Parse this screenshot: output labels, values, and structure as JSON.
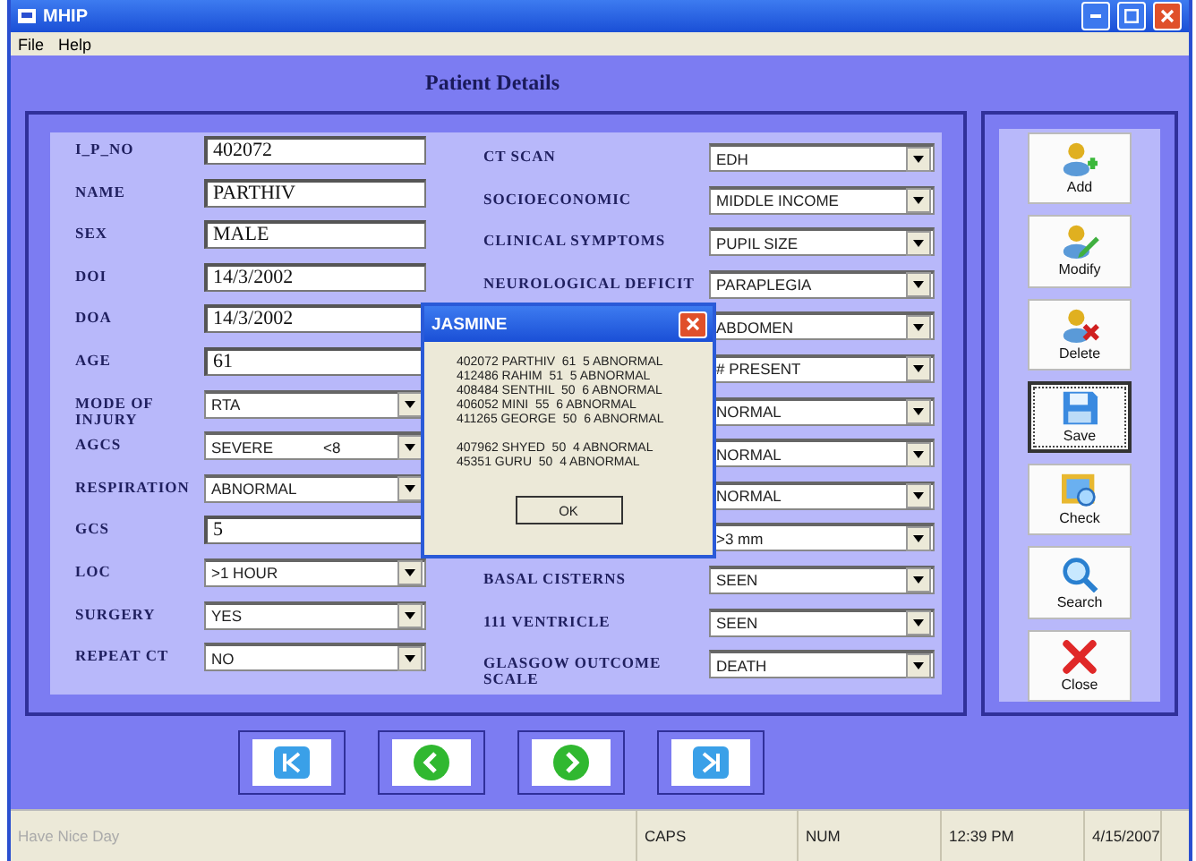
{
  "window": {
    "title": "MHIP"
  },
  "menu": [
    "File",
    "Help"
  ],
  "heading": "Patient Details",
  "left_fields": [
    {
      "label": "I_P_NO",
      "kind": "text",
      "value": "402072"
    },
    {
      "label": "NAME",
      "kind": "text",
      "value": "PARTHIV"
    },
    {
      "label": "SEX",
      "kind": "text",
      "value": "MALE"
    },
    {
      "label": "DOI",
      "kind": "text",
      "value": "14/3/2002"
    },
    {
      "label": "DOA",
      "kind": "text",
      "value": "14/3/2002"
    },
    {
      "label": "AGE",
      "kind": "text",
      "value": "61"
    },
    {
      "label": "MODE OF INJURY",
      "kind": "combo",
      "value": "RTA"
    },
    {
      "label": "AGCS",
      "kind": "combo",
      "value": "SEVERE",
      "value_2": "<8"
    },
    {
      "label": "RESPIRATION",
      "kind": "combo",
      "value": "ABNORMAL"
    },
    {
      "label": "GCS",
      "kind": "text",
      "value": "5"
    },
    {
      "label": "LOC",
      "kind": "combo",
      "value": ">1 HOUR"
    },
    {
      "label": "SURGERY",
      "kind": "combo",
      "value": "YES"
    },
    {
      "label": "REPEAT CT",
      "kind": "combo",
      "value": "NO"
    }
  ],
  "right_fields": [
    {
      "label": "CT SCAN",
      "value": "EDH"
    },
    {
      "label": "SOCIOECONOMIC",
      "value": "MIDDLE INCOME"
    },
    {
      "label": "CLINICAL SYMPTOMS",
      "value": "PUPIL SIZE"
    },
    {
      "label": "NEUROLOGICAL DEFICIT",
      "value": "PARAPLEGIA"
    },
    {
      "value": "ABDOMEN"
    },
    {
      "value": "# PRESENT"
    },
    {
      "value": "NORMAL"
    },
    {
      "value": "NORMAL"
    },
    {
      "value": "NORMAL"
    },
    {
      "value": ">3 mm"
    },
    {
      "label": "BASAL CISTERNS",
      "value": "SEEN"
    },
    {
      "label": "111 VENTRICLE",
      "value": "SEEN"
    },
    {
      "label": "GLASGOW   OUTCOME SCALE",
      "value": "DEATH"
    }
  ],
  "dialog": {
    "title": "JASMINE",
    "line_groups": [
      [
        "402072 PARTHIV  61  5 ABNORMAL",
        "412486 RAHIM  51  5 ABNORMAL",
        "408484 SENTHIL  50  6 ABNORMAL",
        "406052 MINI  55  6 ABNORMAL",
        "411265 GEORGE  50  6 ABNORMAL"
      ],
      [
        "407962 SHYED  50  4 ABNORMAL",
        "45351 GURU  50  4 ABNORMAL"
      ]
    ],
    "button": "OK"
  },
  "side_buttons": [
    {
      "kind": "add",
      "label": "Add",
      "focused": false
    },
    {
      "kind": "modify",
      "label": "Modify",
      "focused": false
    },
    {
      "kind": "delete",
      "label": "Delete",
      "focused": false
    },
    {
      "kind": "save",
      "label": "Save",
      "focused": true
    },
    {
      "kind": "check",
      "label": "Check",
      "focused": false
    },
    {
      "kind": "search",
      "label": "Search",
      "focused": false
    },
    {
      "kind": "close",
      "label": "Close",
      "focused": false
    }
  ],
  "nav_buttons": [
    {
      "kind": "first"
    },
    {
      "kind": "prev"
    },
    {
      "kind": "next"
    },
    {
      "kind": "last"
    }
  ],
  "status_bar": [
    "Have Nice Day",
    "CAPS",
    "NUM",
    "12:39 PM",
    "4/15/2007"
  ]
}
